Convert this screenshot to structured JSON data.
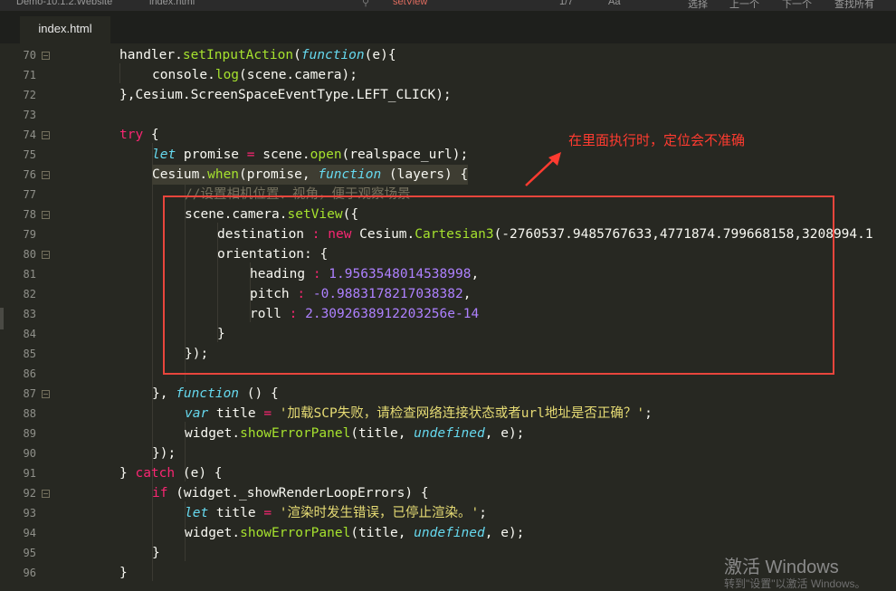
{
  "topbar": {
    "project": "Demo-10.1.2.Website",
    "file": "index.html",
    "search": "setView",
    "item1": "1/7",
    "item2": "Aa",
    "item3": "\"\"",
    "item4": "选择",
    "item5": "上一个",
    "item6": "下一个",
    "item7": "查找所有"
  },
  "tab": {
    "label": "index.html"
  },
  "annotation": {
    "text": "在里面执行时，定位会不准确"
  },
  "watermark": {
    "line1": "激活 Windows",
    "line2": "转到\"设置\"以激活 Windows。"
  },
  "colors": {
    "background": "#272822",
    "annotation_red": "#ff3b30",
    "box_red": "#e8453c"
  },
  "lines": [
    {
      "n": "70",
      "fold": true
    },
    {
      "n": "71",
      "fold": false
    },
    {
      "n": "72",
      "fold": false
    },
    {
      "n": "73",
      "fold": false
    },
    {
      "n": "74",
      "fold": true
    },
    {
      "n": "75",
      "fold": false
    },
    {
      "n": "76",
      "fold": true
    },
    {
      "n": "77",
      "fold": false
    },
    {
      "n": "78",
      "fold": true
    },
    {
      "n": "79",
      "fold": false
    },
    {
      "n": "80",
      "fold": true
    },
    {
      "n": "81",
      "fold": false
    },
    {
      "n": "82",
      "fold": false
    },
    {
      "n": "83",
      "fold": false
    },
    {
      "n": "84",
      "fold": false
    },
    {
      "n": "85",
      "fold": false
    },
    {
      "n": "86",
      "fold": false
    },
    {
      "n": "87",
      "fold": true
    },
    {
      "n": "88",
      "fold": false
    },
    {
      "n": "89",
      "fold": false
    },
    {
      "n": "90",
      "fold": false
    },
    {
      "n": "91",
      "fold": false
    },
    {
      "n": "92",
      "fold": true
    },
    {
      "n": "93",
      "fold": false
    },
    {
      "n": "94",
      "fold": false
    },
    {
      "n": "95",
      "fold": false
    },
    {
      "n": "96",
      "fold": false
    }
  ],
  "code": {
    "l70a": "handler.",
    "l70b": "setInputAction",
    "l70c": "(",
    "l70d": "function",
    "l70e": "(e){",
    "l71a": "console.",
    "l71b": "log",
    "l71c": "(scene.camera);",
    "l72a": "},Cesium.ScreenSpaceEventType.LEFT_CLICK);",
    "l74a": "try",
    "l74b": " {",
    "l75a": "let",
    "l75b": " promise ",
    "l75c": "=",
    "l75d": " scene.",
    "l75e": "open",
    "l75f": "(realspace_url);",
    "l76a": "Cesium.",
    "l76b": "when",
    "l76c": "(promise, ",
    "l76d": "function",
    "l76e": " (layers) {",
    "l77a": "//设置相机位置、视角，便于观察场景",
    "l78a": "scene.camera.",
    "l78b": "setView",
    "l78c": "({",
    "l79a": "destination ",
    "l79b": ":",
    "l79c": " new",
    "l79d": " Cesium.",
    "l79e": "Cartesian3",
    "l79f": "(-2760537.9485767633,4771874.799668158,3208994.1",
    "l80a": "orientation: {",
    "l81a": "heading ",
    "l81b": ":",
    "l81c": " 1.9563548014538998",
    "l81d": ",",
    "l82a": "pitch ",
    "l82b": ":",
    "l82c": " -0.9883178217038382",
    "l82d": ",",
    "l83a": "roll ",
    "l83b": ":",
    "l83c": " 2.3092638912203256e-14",
    "l84a": "}",
    "l85a": "});",
    "l87a": "}, ",
    "l87b": "function",
    "l87c": " () {",
    "l88a": "var",
    "l88b": " title ",
    "l88c": "=",
    "l88d": " '加载SCP失败，请检查网络连接状态或者url地址是否正确？'",
    "l88e": ";",
    "l89a": "widget.",
    "l89b": "showErrorPanel",
    "l89c": "(title, ",
    "l89d": "undefined",
    "l89e": ", e);",
    "l90a": "});",
    "l91a": "} ",
    "l91b": "catch",
    "l91c": " (e) {",
    "l92a": "if",
    "l92b": " (widget._showRenderLoopErrors) {",
    "l93a": "let",
    "l93b": " title ",
    "l93c": "=",
    "l93d": " '渲染时发生错误，已停止渲染。'",
    "l93e": ";",
    "l94a": "widget.",
    "l94b": "showErrorPanel",
    "l94c": "(title, ",
    "l94d": "undefined",
    "l94e": ", e);",
    "l95a": "}",
    "l96a": "}"
  }
}
